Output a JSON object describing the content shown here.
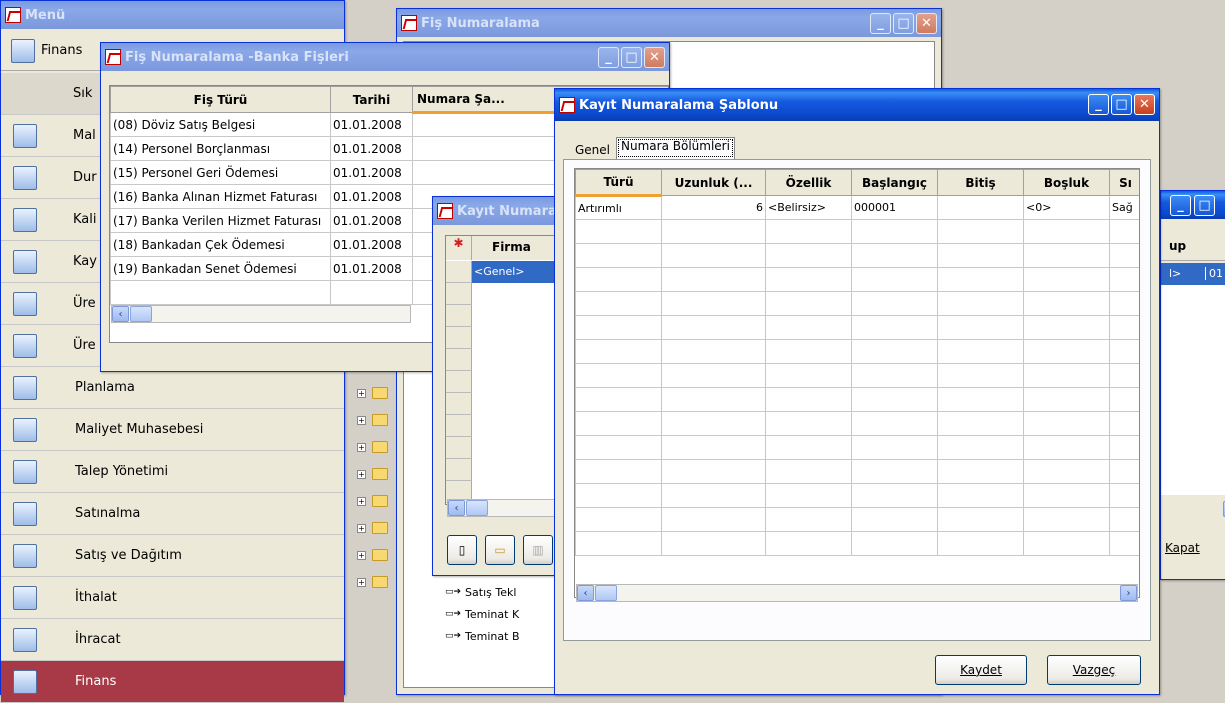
{
  "menu_window": {
    "title": "Menü",
    "top_item": "Finans",
    "items": [
      {
        "label": "Sık"
      },
      {
        "label": "Mal"
      },
      {
        "label": "Dur"
      },
      {
        "label": "Kali"
      },
      {
        "label": "Kay"
      },
      {
        "label": "Üre"
      },
      {
        "label": "Üre"
      },
      {
        "label": "Planlama"
      },
      {
        "label": "Maliyet Muhasebesi"
      },
      {
        "label": "Talep Yönetimi"
      },
      {
        "label": "Satınalma"
      },
      {
        "label": "Satış ve Dağıtım"
      },
      {
        "label": "İthalat"
      },
      {
        "label": "İhracat"
      },
      {
        "label": "Finans"
      }
    ]
  },
  "fis_window": {
    "title": "Fiş Numaralama"
  },
  "banka_window": {
    "title": "Fiş Numaralama -Banka Fişleri",
    "columns": [
      "Fiş Türü",
      "Tarihi",
      "Numara Şa..."
    ],
    "rows": [
      [
        "(08) Döviz Satış Belgesi",
        "01.01.2008"
      ],
      [
        "(14) Personel Borçlanması",
        "01.01.2008"
      ],
      [
        "(15) Personel Geri Ödemesi",
        "01.01.2008"
      ],
      [
        "(16) Banka Alınan Hizmet Faturası",
        "01.01.2008"
      ],
      [
        "(17) Banka Verilen Hizmet Faturası",
        "01.01.2008"
      ],
      [
        "(18) Bankadan Çek Ödemesi",
        "01.01.2008"
      ],
      [
        "(19) Bankadan Senet Ödemesi",
        "01.01.2008"
      ]
    ]
  },
  "kayit_small_window": {
    "title": "Kayıt Numaralama",
    "column": "Firma",
    "row": "<Genel>"
  },
  "right_window": {
    "col_frag": "up",
    "row_frag1": "l>",
    "row_frag2": "01",
    "close_label": "Kapat"
  },
  "tree_items": [
    "Satış Tekl",
    "Teminat K",
    "Teminat B"
  ],
  "sablon_window": {
    "title": "Kayıt Numaralama Şablonu",
    "tabs": [
      "Genel",
      "Numara Bölümleri"
    ],
    "columns": [
      "Türü",
      "Uzunluk (...",
      "Özellik",
      "Başlangıç",
      "Bitiş",
      "Boşluk",
      "Sı"
    ],
    "row": [
      "Artırımlı",
      "6",
      "<Belirsiz>",
      "000001",
      "",
      "<0>",
      "Sağ"
    ],
    "save_label": "Kaydet",
    "cancel_label": "Vazgeç"
  }
}
